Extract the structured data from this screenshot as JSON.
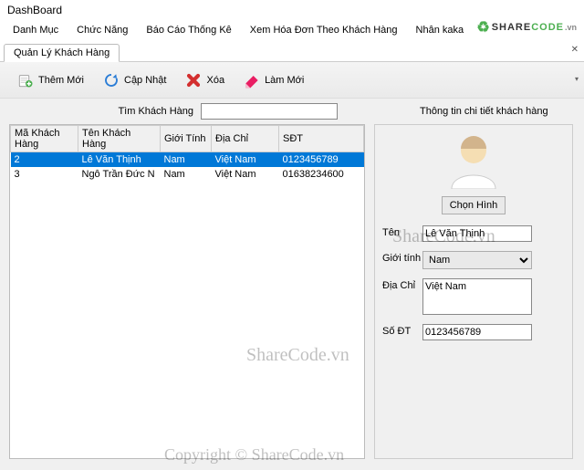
{
  "window": {
    "title": "DashBoard"
  },
  "logo": {
    "share": "SHARE",
    "code": "CODE",
    "vn": ".vn"
  },
  "menu": [
    "Danh Mục",
    "Chức Năng",
    "Báo Cáo Thống Kê",
    "Xem Hóa Đơn Theo Khách Hàng",
    "Nhân kaka"
  ],
  "tab": {
    "label": "Quản Lý Khách Hàng"
  },
  "toolbar": {
    "add": "Thêm Mới",
    "update": "Cập Nhật",
    "delete": "Xóa",
    "refresh": "Làm Mới"
  },
  "search": {
    "label": "Tìm Khách Hàng",
    "value": ""
  },
  "detail_title": "Thông tin chi tiết khách hàng",
  "table": {
    "headers": [
      "Mã Khách Hàng",
      "Tên Khách Hàng",
      "Giới Tính",
      "Địa Chỉ",
      "SĐT"
    ],
    "rows": [
      {
        "id": "2",
        "name": "Lê Văn Thịnh",
        "gender": "Nam",
        "addr": "Việt Nam",
        "phone": "0123456789",
        "selected": true
      },
      {
        "id": "3",
        "name": "Ngô Trần Đức N",
        "gender": "Nam",
        "addr": "Việt Nam",
        "phone": "01638234600",
        "selected": false
      }
    ]
  },
  "detail": {
    "choose": "Chọn Hình",
    "name_lbl": "Tên",
    "name_val": "Lê Văn Thịnh",
    "gender_lbl": "Giới tính",
    "gender_val": "Nam",
    "addr_lbl": "Địa Chỉ",
    "addr_val": "Việt Nam",
    "phone_lbl": "Số ĐT",
    "phone_val": "0123456789"
  },
  "watermark": {
    "sc": "ShareCode.vn",
    "copy": "Copyright © ShareCode.vn"
  }
}
